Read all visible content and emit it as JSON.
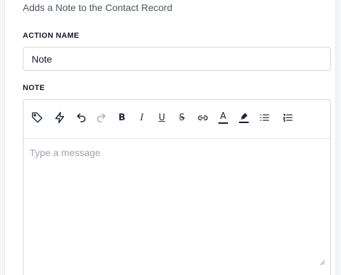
{
  "subtitle": "Adds a Note to the Contact Record",
  "action_name": {
    "label": "ACTION NAME",
    "value": "Note"
  },
  "note": {
    "label": "NOTE",
    "placeholder": "Type a message",
    "value": ""
  },
  "toolbar": {
    "bold": "B",
    "italic": "I",
    "underline": "U",
    "strikethrough": "S",
    "text_color": "A",
    "icons": [
      "tag-icon",
      "lightning-icon",
      "undo-icon",
      "redo-icon",
      "bold-icon",
      "italic-icon",
      "underline-icon",
      "strikethrough-icon",
      "link-icon",
      "text-color-icon",
      "highlight-icon",
      "bullet-list-icon",
      "numbered-list-icon"
    ]
  },
  "colors": {
    "text_color_bar": "#111827",
    "highlight_bar": "#111827",
    "border": "#d1d5db",
    "placeholder": "#9ca3af"
  }
}
